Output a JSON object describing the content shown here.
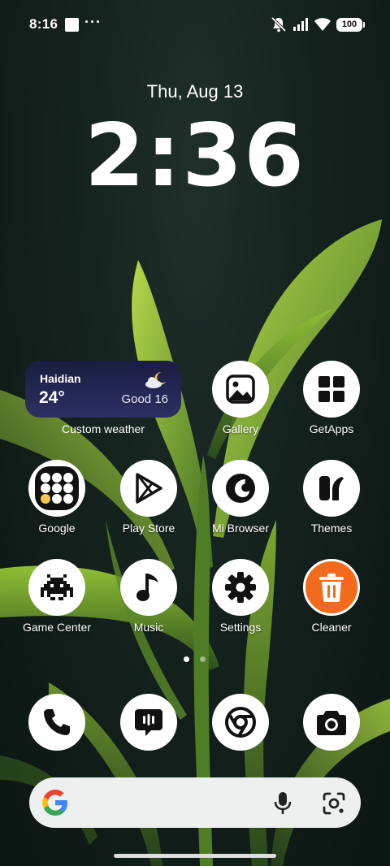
{
  "status_bar": {
    "time": "8:16",
    "overflow": "···",
    "battery": "100",
    "icons": [
      "notification-square-icon",
      "mute-icon",
      "signal-icon",
      "wifi-icon",
      "battery-icon"
    ]
  },
  "lockclock": {
    "date": "Thu, Aug 13",
    "time": "2:36"
  },
  "weather_widget": {
    "city": "Haidian",
    "temperature": "24°",
    "condition": "Good 16",
    "label": "Custom weather",
    "background": "#22254f"
  },
  "apps": [
    {
      "label": "Gallery",
      "icon": "gallery-icon"
    },
    {
      "label": "GetApps",
      "icon": "getapps-icon"
    },
    {
      "label": "Google",
      "icon": "google-folder-icon"
    },
    {
      "label": "Play Store",
      "icon": "play-store-icon"
    },
    {
      "label": "Mi Browser",
      "icon": "mi-browser-icon"
    },
    {
      "label": "Themes",
      "icon": "themes-icon"
    },
    {
      "label": "Game Center",
      "icon": "game-center-icon"
    },
    {
      "label": "Music",
      "icon": "music-icon"
    },
    {
      "label": "Settings",
      "icon": "settings-icon"
    },
    {
      "label": "Cleaner",
      "icon": "cleaner-icon",
      "accent": "#f26a1b"
    }
  ],
  "dock": [
    {
      "name": "phone",
      "icon": "phone-icon"
    },
    {
      "name": "messages",
      "icon": "messages-icon"
    },
    {
      "name": "chrome",
      "icon": "chrome-icon"
    },
    {
      "name": "camera",
      "icon": "camera-icon"
    }
  ],
  "page_indicator": {
    "pages": 2,
    "active": 1
  },
  "search_bar": {
    "icons": [
      "google-g-icon",
      "mic-icon",
      "lens-icon"
    ]
  }
}
